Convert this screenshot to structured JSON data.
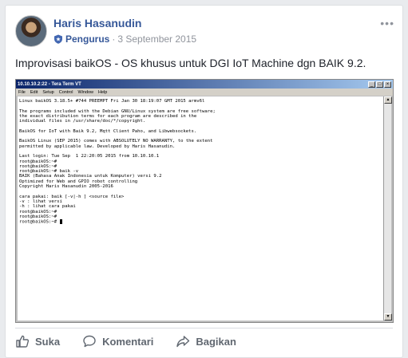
{
  "post": {
    "author": "Haris Hasanudin",
    "role": "Pengurus",
    "separator": "·",
    "date": "3 September 2015",
    "menu_icon": "more-dots-icon",
    "text": "Improvisasi baikOS - OS khusus untuk DGI IoT Machine dgn BAIK 9.2."
  },
  "terminal": {
    "title": "10.10.10.2:22 - Tera Term VT",
    "controls": [
      "_",
      "□",
      "×"
    ],
    "menu": [
      "File",
      "Edit",
      "Setup",
      "Control",
      "Window",
      "Help"
    ],
    "scroll_up": "▲",
    "scroll_down": "▼",
    "lines": [
      "Linux baikOS 3.18.5+ #744 PREEMPT Fri Jan 30 18:19:07 GMT 2015 armv6l",
      "",
      "The programs included with the Debian GNU/Linux system are free software;",
      "the exact distribution terms for each program are described in the",
      "individual files in /usr/share/doc/*/copyright.",
      "",
      "BaikOS for IoT with Baik 9.2, Mqtt Client Paho, and Libwebsockets.",
      "",
      "BaikOS Linux (SEP 2015) comes with ABSOLUTELY NO WARRANTY, to the extent",
      "permitted by applicable law. Developed by Haris Hasanudin.",
      "",
      "Last login: Tue Sep  1 22:20:05 2015 from 10.10.10.1",
      "root@baikOS:~#",
      "root@baikOS:~#",
      "root@baikOS:~# baik -v",
      "BAIK (Bahasa Anak Indonesia untuk Komputer) versi 9.2",
      "Optimized for Web and GPIO robot controlling",
      "Copyright Haris Hasanudin 2005-2016",
      "",
      "cara pakai: baik [-v|-h ] <source file>",
      "-v : lihat versi",
      "-h : lihat cara pakai",
      "root@baikOS:~#",
      "root@baikOS:~#",
      "root@baikOS:~#"
    ]
  },
  "actions": {
    "like": "Suka",
    "comment": "Komentari",
    "share": "Bagikan"
  }
}
